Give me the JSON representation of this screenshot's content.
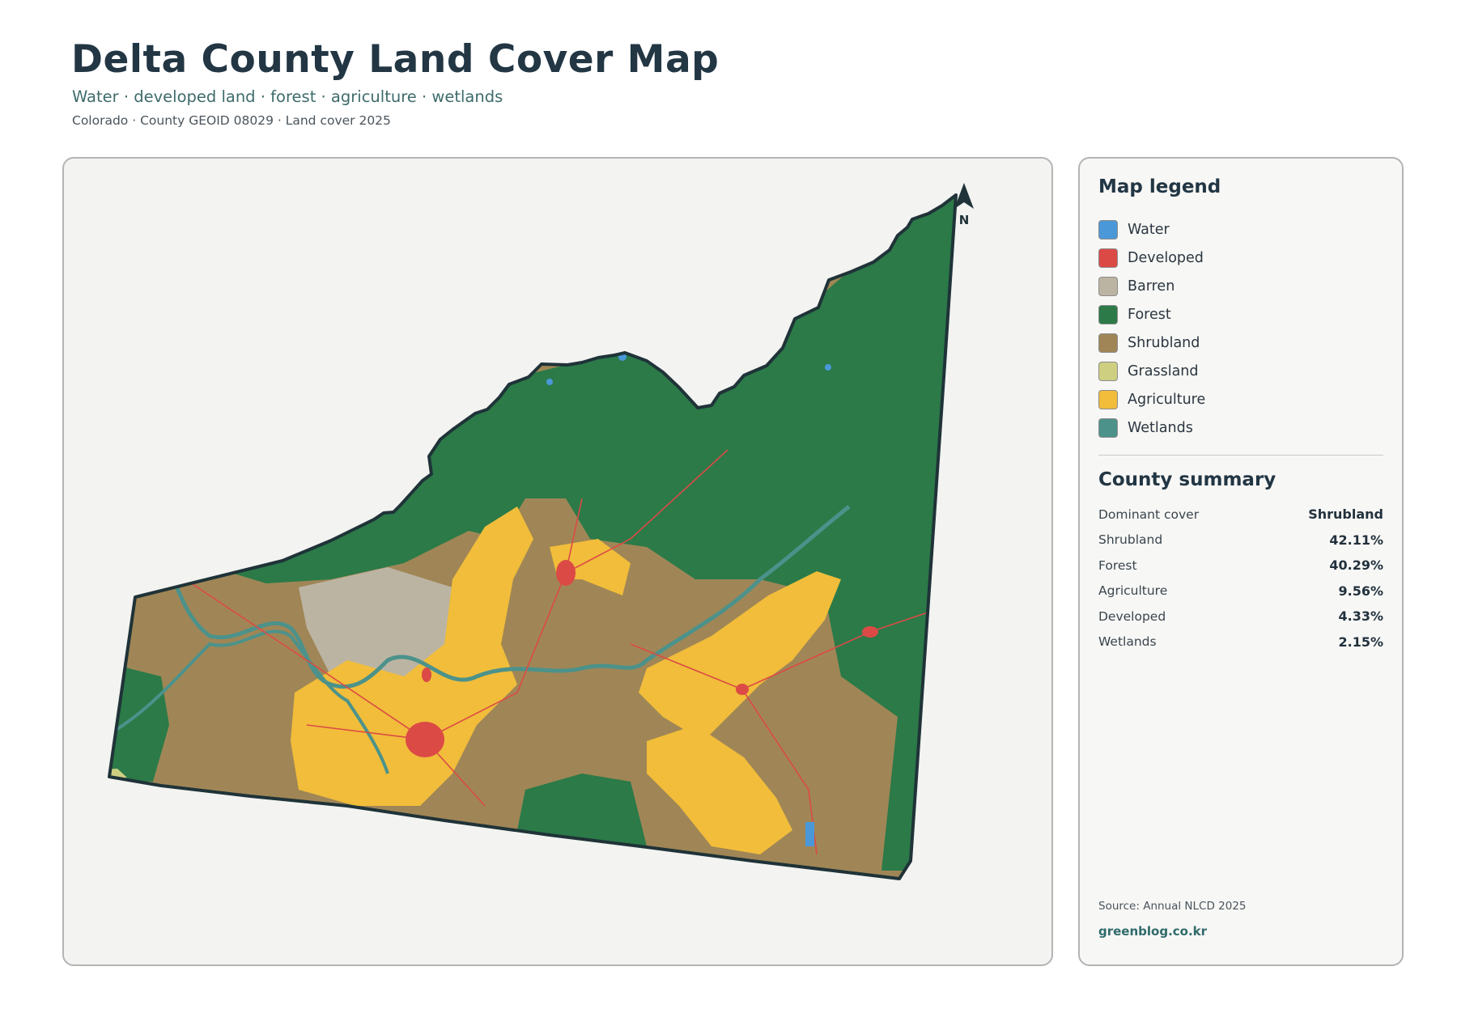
{
  "header": {
    "title": "Delta County Land Cover Map",
    "subtitle": "Water · developed land · forest · agriculture · wetlands",
    "meta": "Colorado · County GEOID 08029 · Land cover 2025"
  },
  "map": {
    "north_label": "N",
    "colors": {
      "water": "#4a98d8",
      "developed": "#dc4a46",
      "barren": "#bcb4a3",
      "forest": "#2b7a48",
      "shrubland": "#a08656",
      "grassland": "#cfcf82",
      "agriculture": "#f1bd3a",
      "wetlands": "#4c928b",
      "border": "#1f3338"
    }
  },
  "legend": {
    "title": "Map legend",
    "items": [
      {
        "label": "Water",
        "color": "#4a98d8"
      },
      {
        "label": "Developed",
        "color": "#dc4a46"
      },
      {
        "label": "Barren",
        "color": "#bcb4a3"
      },
      {
        "label": "Forest",
        "color": "#2b7a48"
      },
      {
        "label": "Shrubland",
        "color": "#a08656"
      },
      {
        "label": "Grassland",
        "color": "#cfcf82"
      },
      {
        "label": "Agriculture",
        "color": "#f1bd3a"
      },
      {
        "label": "Wetlands",
        "color": "#4c928b"
      }
    ]
  },
  "summary": {
    "title": "County summary",
    "rows": [
      {
        "key": "Dominant cover",
        "value": "Shrubland"
      },
      {
        "key": "Shrubland",
        "value": "42.11%"
      },
      {
        "key": "Forest",
        "value": "40.29%"
      },
      {
        "key": "Agriculture",
        "value": "9.56%"
      },
      {
        "key": "Developed",
        "value": "4.33%"
      },
      {
        "key": "Wetlands",
        "value": "2.15%"
      }
    ]
  },
  "footer": {
    "source": "Source: Annual NLCD 2025",
    "credit": "greenblog.co.kr"
  }
}
